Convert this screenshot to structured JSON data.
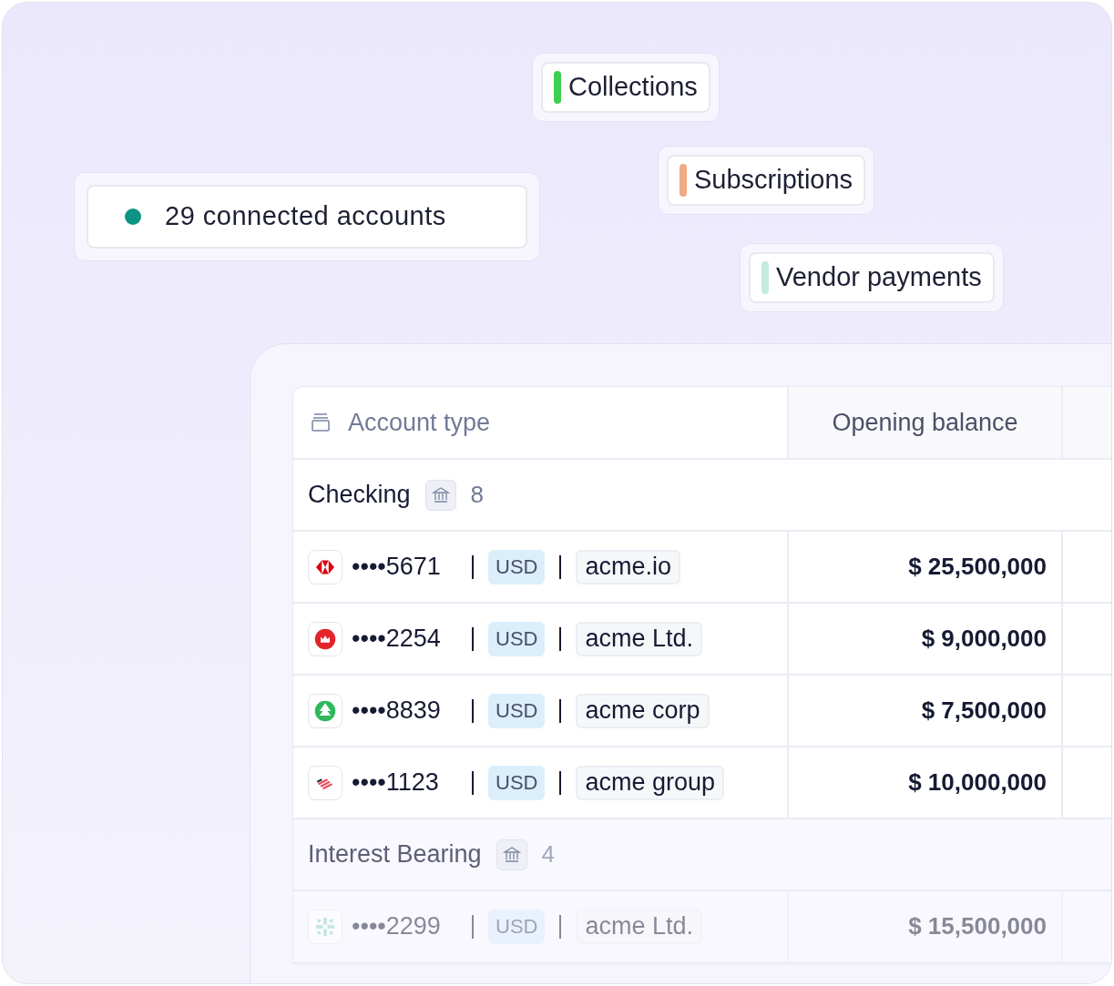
{
  "status_chip": {
    "text": "29 connected accounts",
    "color": "#0e9384"
  },
  "tags": [
    {
      "label": "Collections",
      "color": "#3fcf4f"
    },
    {
      "label": "Subscriptions",
      "color": "#f2aa82"
    },
    {
      "label": "Vendor payments",
      "color": "#c3ebe2"
    }
  ],
  "table": {
    "columns": [
      "Account type",
      "Opening balance"
    ],
    "groups": [
      {
        "name": "Checking",
        "count": "8",
        "dimmed": false,
        "rows": [
          {
            "kind": "hexagon",
            "account": "••••5671",
            "currency": "USD",
            "entity": "acme.io",
            "balance": "$ 25,500,000"
          },
          {
            "kind": "circle",
            "account": "••••2254",
            "currency": "USD",
            "entity": "acme Ltd.",
            "balance": "$ 9,000,000"
          },
          {
            "kind": "tree",
            "account": "••••8839",
            "currency": "USD",
            "entity": "acme corp",
            "balance": "$ 7,500,000"
          },
          {
            "kind": "stripes",
            "account": "••••1123",
            "currency": "USD",
            "entity": "acme group",
            "balance": "$ 10,000,000"
          }
        ]
      },
      {
        "name": "Interest Bearing",
        "count": "4",
        "dimmed": true,
        "rows": [
          {
            "kind": "star",
            "account": "••••2299",
            "currency": "USD",
            "entity": "acme Ltd.",
            "balance": "$ 15,500,000"
          }
        ]
      }
    ]
  }
}
